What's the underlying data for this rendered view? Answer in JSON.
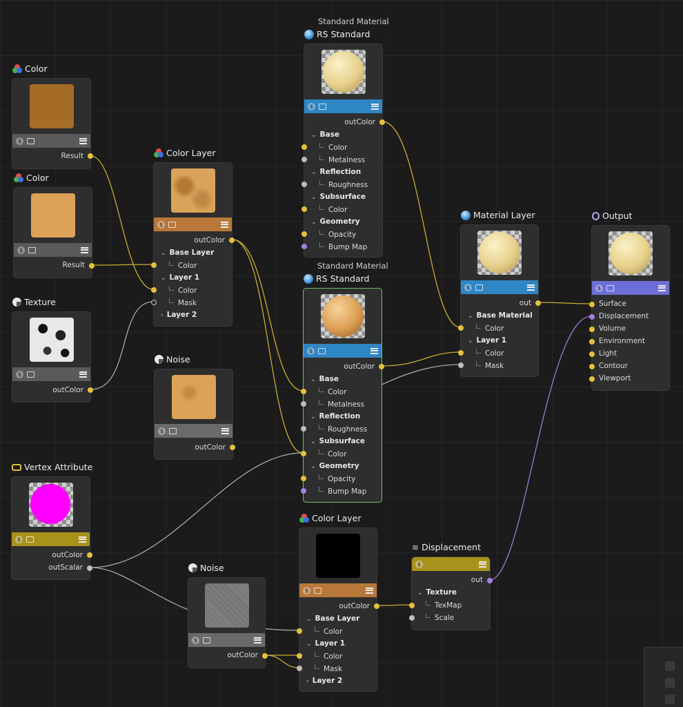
{
  "nodes": {
    "color1": {
      "title": "Color",
      "port_out": "Result",
      "swatch": "#a46c27"
    },
    "color2": {
      "title": "Color",
      "port_out": "Result",
      "swatch": "#dca257"
    },
    "texture": {
      "title": "Texture",
      "port_out": "outColor"
    },
    "color_layer1": {
      "title": "Color Layer",
      "port_out": "outColor",
      "base_layer": "Base Layer",
      "color": "Color",
      "layer1": "Layer 1",
      "mask": "Mask",
      "layer2": "Layer 2"
    },
    "noise1": {
      "title": "Noise",
      "port_out": "outColor"
    },
    "rs1": {
      "subtitle": "Standard Material",
      "title": "RS Standard",
      "port_out": "outColor",
      "base": "Base",
      "color": "Color",
      "metalness": "Metalness",
      "reflection": "Reflection",
      "roughness": "Roughness",
      "subsurface": "Subsurface",
      "geometry": "Geometry",
      "opacity": "Opacity",
      "bump": "Bump Map"
    },
    "rs2": {
      "subtitle": "Standard Material",
      "title": "RS Standard",
      "port_out": "outColor",
      "base": "Base",
      "color": "Color",
      "metalness": "Metalness",
      "reflection": "Reflection",
      "roughness": "Roughness",
      "subsurface": "Subsurface",
      "geometry": "Geometry",
      "opacity": "Opacity",
      "bump": "Bump Map"
    },
    "material_layer": {
      "title": "Material Layer",
      "port_out": "out",
      "base_material": "Base Material",
      "color": "Color",
      "layer1": "Layer 1",
      "mask": "Mask"
    },
    "output": {
      "title": "Output",
      "surface": "Surface",
      "displacement": "Displacement",
      "volume": "Volume",
      "environment": "Environment",
      "light": "Light",
      "contour": "Contour",
      "viewport": "Viewport"
    },
    "vertex": {
      "title": "Vertex Attribute",
      "out_color": "outColor",
      "out_scalar": "outScalar"
    },
    "noise2": {
      "title": "Noise",
      "port_out": "outColor"
    },
    "color_layer2": {
      "title": "Color Layer",
      "port_out": "outColor",
      "base_layer": "Base Layer",
      "color": "Color",
      "layer1": "Layer 1",
      "mask": "Mask",
      "layer2": "Layer 2"
    },
    "displacement": {
      "title": "Displacement",
      "port_out": "out",
      "texture": "Texture",
      "texmap": "TexMap",
      "scale": "Scale"
    }
  },
  "colors": {
    "wire_color": "#c9ad36",
    "wire_scalar": "#a8a8a8",
    "wire_displace": "#9a7ad8",
    "bar_blue": "#2f86c4",
    "bar_orange": "#b7783a",
    "bar_gray": "#6a6a6a",
    "bar_yellow": "#a8921c",
    "bar_purple": "#6e6ed8",
    "selected_border": "#6fbf6a"
  }
}
